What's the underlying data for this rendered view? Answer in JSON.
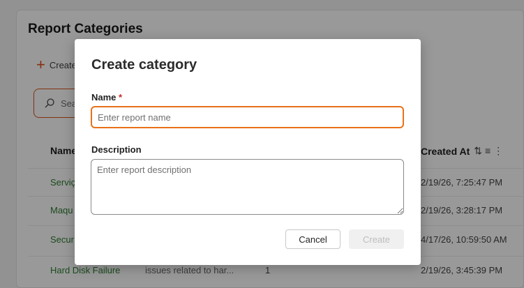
{
  "page": {
    "title": "Report Categories",
    "create_label": "Create",
    "search_placeholder": "Search"
  },
  "table": {
    "headers": {
      "name": "Name",
      "created_at": "Created At"
    },
    "rows": [
      {
        "name": "Serviç",
        "description": "",
        "count": "",
        "created_at": "2/19/26, 7:25:47 PM"
      },
      {
        "name": "Maqu",
        "description": "",
        "count": "",
        "created_at": "2/19/26, 3:28:17 PM"
      },
      {
        "name": "Secur",
        "description": "",
        "count": "",
        "created_at": "4/17/26, 10:59:50 AM"
      },
      {
        "name": "Hard Disk Failure",
        "description": "issues related to har...",
        "count": "1",
        "created_at": "2/19/26, 3:45:39 PM"
      }
    ]
  },
  "dialog": {
    "title": "Create category",
    "name_label": "Name",
    "required_mark": "*",
    "name_placeholder": "Enter report name",
    "name_value": "",
    "description_label": "Description",
    "description_placeholder": "Enter report description",
    "description_value": "",
    "cancel_label": "Cancel",
    "create_label": "Create"
  },
  "colors": {
    "accent": "#e8711a",
    "link_green": "#2e7d32",
    "required_red": "#c62828"
  }
}
